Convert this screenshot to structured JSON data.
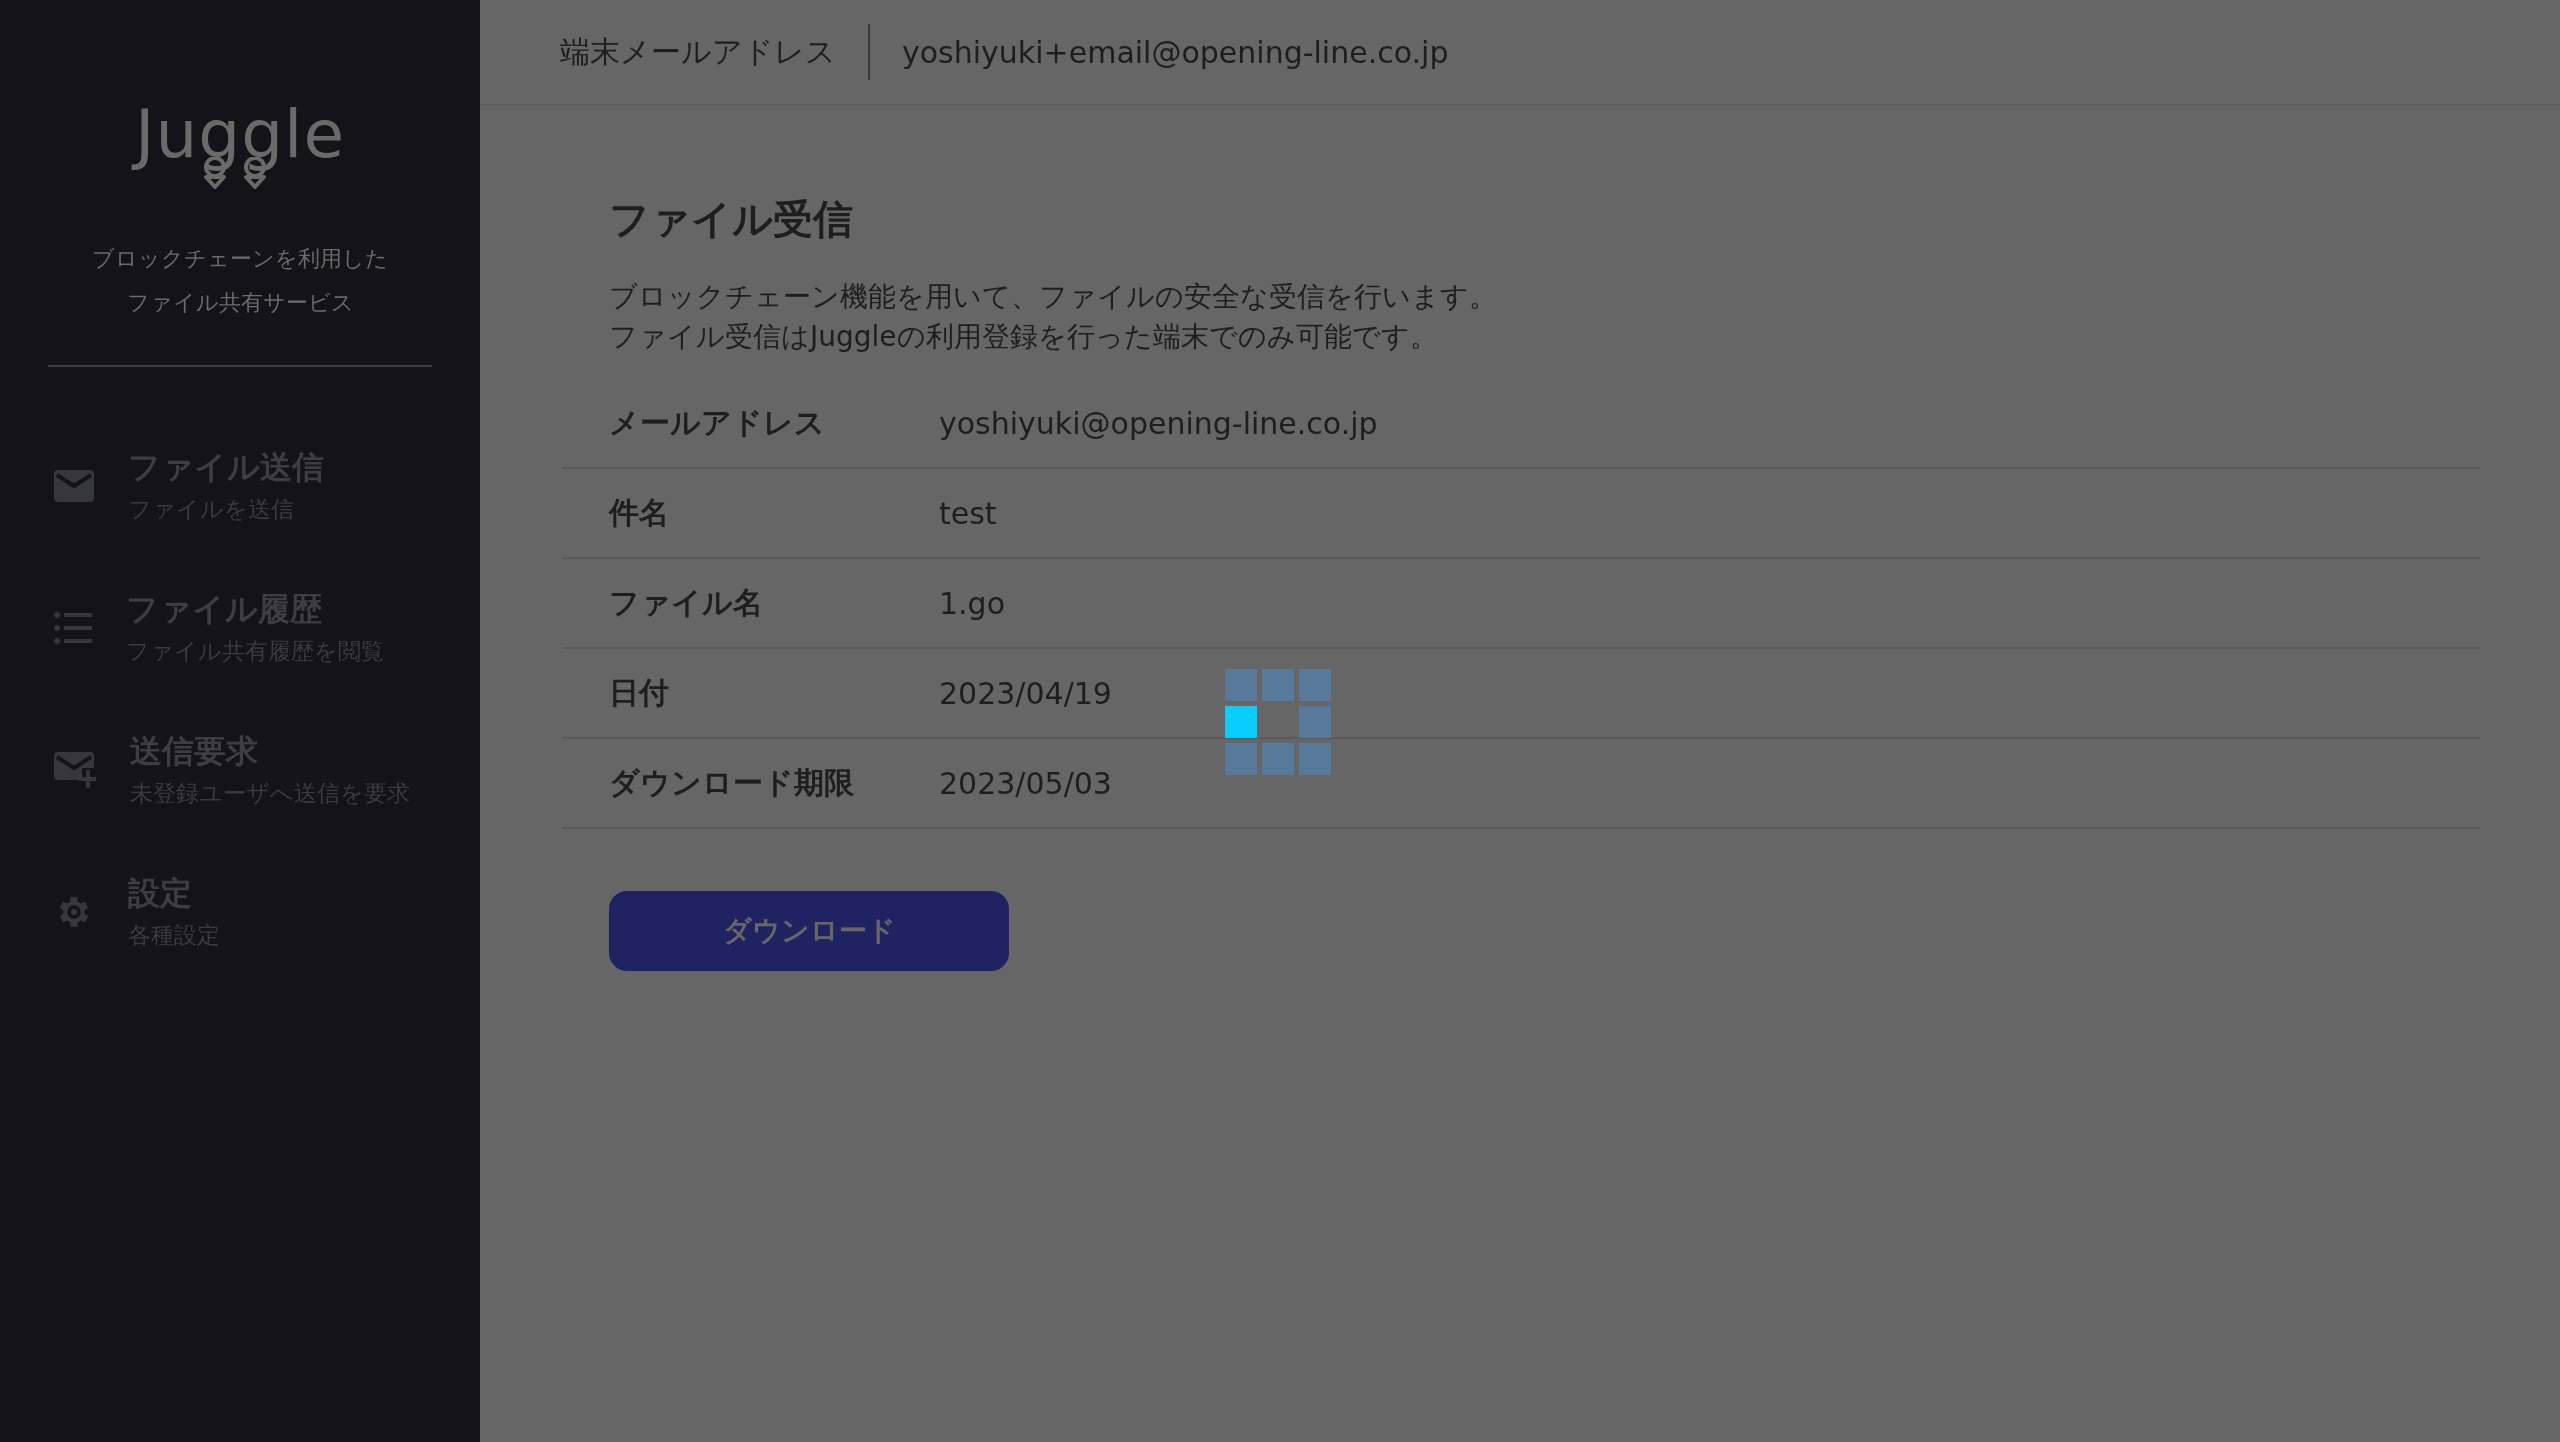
{
  "sidebar": {
    "logo": "Juggle",
    "tagline": [
      "ブロックチェーンを利用した",
      "ファイル共有サービス"
    ],
    "items": [
      {
        "kind": "send",
        "title": "ファイル送信",
        "subtitle": "ファイルを送信"
      },
      {
        "kind": "history",
        "title": "ファイル履歴",
        "subtitle": "ファイル共有履歴を閲覧"
      },
      {
        "kind": "request",
        "title": "送信要求",
        "subtitle": "未登録ユーザへ送信を要求"
      },
      {
        "kind": "settings",
        "title": "設定",
        "subtitle": "各種設定"
      }
    ]
  },
  "header": {
    "label": "端末メールアドレス",
    "value": "yoshiyuki+email@opening-line.co.jp"
  },
  "page": {
    "title": "ファイル受信",
    "description": [
      "ブロックチェーン機能を用いて、ファイルの安全な受信を行います。",
      "ファイル受信はJuggleの利用登録を行った端末でのみ可能です。"
    ],
    "rows": [
      {
        "label": "メールアドレス",
        "value": "yoshiyuki@opening-line.co.jp"
      },
      {
        "label": "件名",
        "value": "test"
      },
      {
        "label": "ファイル名",
        "value": "1.go"
      },
      {
        "label": "日付",
        "value": "2023/04/19"
      },
      {
        "label": "ダウンロード期限",
        "value": "2023/05/03"
      }
    ],
    "button": "ダウンロード"
  }
}
